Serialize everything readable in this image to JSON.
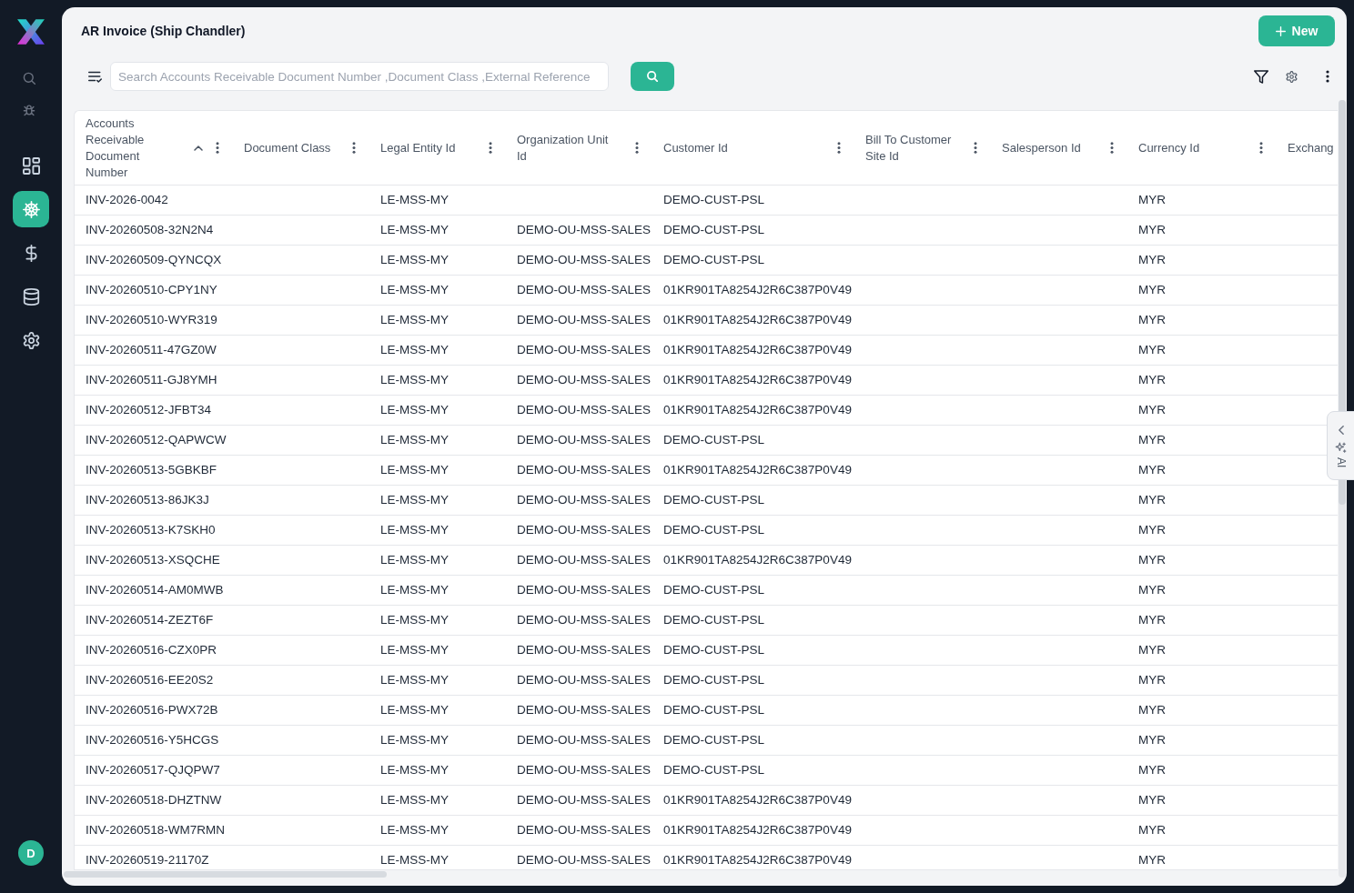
{
  "sidebar": {
    "nav_items": [
      {
        "selected": false
      },
      {
        "selected": true
      },
      {
        "selected": false
      },
      {
        "selected": false
      },
      {
        "selected": false
      }
    ],
    "user_initial": "D"
  },
  "header": {
    "title": "AR Invoice (Ship Chandler)",
    "new_button": "New"
  },
  "toolbar": {
    "search": {
      "placeholder": "Search Accounts Receivable Document Number ,Document Class ,External Reference"
    }
  },
  "table": {
    "columns": [
      {
        "label": "Accounts Receivable Document Number",
        "sorted": true
      },
      {
        "label": "Document Class",
        "sorted": false
      },
      {
        "label": "Legal Entity Id",
        "sorted": false
      },
      {
        "label": "Organization Unit Id",
        "sorted": false
      },
      {
        "label": "Customer Id",
        "sorted": false
      },
      {
        "label": "Bill To Customer Site Id",
        "sorted": false
      },
      {
        "label": "Salesperson Id",
        "sorted": false
      },
      {
        "label": "Currency Id",
        "sorted": false
      },
      {
        "label": "Exchang",
        "sorted": false
      }
    ],
    "rows": [
      {
        "document_number": "INV-2026-0042",
        "legal_entity_id": "LE-MSS-MY",
        "customer_id": "DEMO-CUST-PSL",
        "currency_id": "MYR"
      },
      {
        "document_number": "INV-20260508-32N2N4",
        "legal_entity_id": "LE-MSS-MY",
        "organization_unit_id": "DEMO-OU-MSS-SALES",
        "customer_id": "DEMO-CUST-PSL",
        "currency_id": "MYR"
      },
      {
        "document_number": "INV-20260509-QYNCQX",
        "legal_entity_id": "LE-MSS-MY",
        "organization_unit_id": "DEMO-OU-MSS-SALES",
        "customer_id": "DEMO-CUST-PSL",
        "currency_id": "MYR"
      },
      {
        "document_number": "INV-20260510-CPY1NY",
        "legal_entity_id": "LE-MSS-MY",
        "organization_unit_id": "DEMO-OU-MSS-SALES",
        "customer_id": "01KR901TA8254J2R6C387P0V49",
        "currency_id": "MYR"
      },
      {
        "document_number": "INV-20260510-WYR319",
        "legal_entity_id": "LE-MSS-MY",
        "organization_unit_id": "DEMO-OU-MSS-SALES",
        "customer_id": "01KR901TA8254J2R6C387P0V49",
        "currency_id": "MYR"
      },
      {
        "document_number": "INV-20260511-47GZ0W",
        "legal_entity_id": "LE-MSS-MY",
        "organization_unit_id": "DEMO-OU-MSS-SALES",
        "customer_id": "01KR901TA8254J2R6C387P0V49",
        "currency_id": "MYR"
      },
      {
        "document_number": "INV-20260511-GJ8YMH",
        "legal_entity_id": "LE-MSS-MY",
        "organization_unit_id": "DEMO-OU-MSS-SALES",
        "customer_id": "01KR901TA8254J2R6C387P0V49",
        "currency_id": "MYR"
      },
      {
        "document_number": "INV-20260512-JFBT34",
        "legal_entity_id": "LE-MSS-MY",
        "organization_unit_id": "DEMO-OU-MSS-SALES",
        "customer_id": "01KR901TA8254J2R6C387P0V49",
        "currency_id": "MYR"
      },
      {
        "document_number": "INV-20260512-QAPWCW",
        "legal_entity_id": "LE-MSS-MY",
        "organization_unit_id": "DEMO-OU-MSS-SALES",
        "customer_id": "DEMO-CUST-PSL",
        "currency_id": "MYR"
      },
      {
        "document_number": "INV-20260513-5GBKBF",
        "legal_entity_id": "LE-MSS-MY",
        "organization_unit_id": "DEMO-OU-MSS-SALES",
        "customer_id": "01KR901TA8254J2R6C387P0V49",
        "currency_id": "MYR"
      },
      {
        "document_number": "INV-20260513-86JK3J",
        "legal_entity_id": "LE-MSS-MY",
        "organization_unit_id": "DEMO-OU-MSS-SALES",
        "customer_id": "DEMO-CUST-PSL",
        "currency_id": "MYR"
      },
      {
        "document_number": "INV-20260513-K7SKH0",
        "legal_entity_id": "LE-MSS-MY",
        "organization_unit_id": "DEMO-OU-MSS-SALES",
        "customer_id": "DEMO-CUST-PSL",
        "currency_id": "MYR"
      },
      {
        "document_number": "INV-20260513-XSQCHE",
        "legal_entity_id": "LE-MSS-MY",
        "organization_unit_id": "DEMO-OU-MSS-SALES",
        "customer_id": "01KR901TA8254J2R6C387P0V49",
        "currency_id": "MYR"
      },
      {
        "document_number": "INV-20260514-AM0MWB",
        "legal_entity_id": "LE-MSS-MY",
        "organization_unit_id": "DEMO-OU-MSS-SALES",
        "customer_id": "DEMO-CUST-PSL",
        "currency_id": "MYR"
      },
      {
        "document_number": "INV-20260514-ZEZT6F",
        "legal_entity_id": "LE-MSS-MY",
        "organization_unit_id": "DEMO-OU-MSS-SALES",
        "customer_id": "DEMO-CUST-PSL",
        "currency_id": "MYR"
      },
      {
        "document_number": "INV-20260516-CZX0PR",
        "legal_entity_id": "LE-MSS-MY",
        "organization_unit_id": "DEMO-OU-MSS-SALES",
        "customer_id": "DEMO-CUST-PSL",
        "currency_id": "MYR"
      },
      {
        "document_number": "INV-20260516-EE20S2",
        "legal_entity_id": "LE-MSS-MY",
        "organization_unit_id": "DEMO-OU-MSS-SALES",
        "customer_id": "DEMO-CUST-PSL",
        "currency_id": "MYR"
      },
      {
        "document_number": "INV-20260516-PWX72B",
        "legal_entity_id": "LE-MSS-MY",
        "organization_unit_id": "DEMO-OU-MSS-SALES",
        "customer_id": "DEMO-CUST-PSL",
        "currency_id": "MYR"
      },
      {
        "document_number": "INV-20260516-Y5HCGS",
        "legal_entity_id": "LE-MSS-MY",
        "organization_unit_id": "DEMO-OU-MSS-SALES",
        "customer_id": "DEMO-CUST-PSL",
        "currency_id": "MYR"
      },
      {
        "document_number": "INV-20260517-QJQPW7",
        "legal_entity_id": "LE-MSS-MY",
        "organization_unit_id": "DEMO-OU-MSS-SALES",
        "customer_id": "DEMO-CUST-PSL",
        "currency_id": "MYR"
      },
      {
        "document_number": "INV-20260518-DHZTNW",
        "legal_entity_id": "LE-MSS-MY",
        "organization_unit_id": "DEMO-OU-MSS-SALES",
        "customer_id": "01KR901TA8254J2R6C387P0V49",
        "currency_id": "MYR"
      },
      {
        "document_number": "INV-20260518-WM7RMN",
        "legal_entity_id": "LE-MSS-MY",
        "organization_unit_id": "DEMO-OU-MSS-SALES",
        "customer_id": "01KR901TA8254J2R6C387P0V49",
        "currency_id": "MYR"
      },
      {
        "document_number": "INV-20260519-21170Z",
        "legal_entity_id": "LE-MSS-MY",
        "organization_unit_id": "DEMO-OU-MSS-SALES",
        "customer_id": "01KR901TA8254J2R6C387P0V49",
        "currency_id": "MYR"
      }
    ]
  },
  "ai_tab": {
    "label": "AI"
  }
}
